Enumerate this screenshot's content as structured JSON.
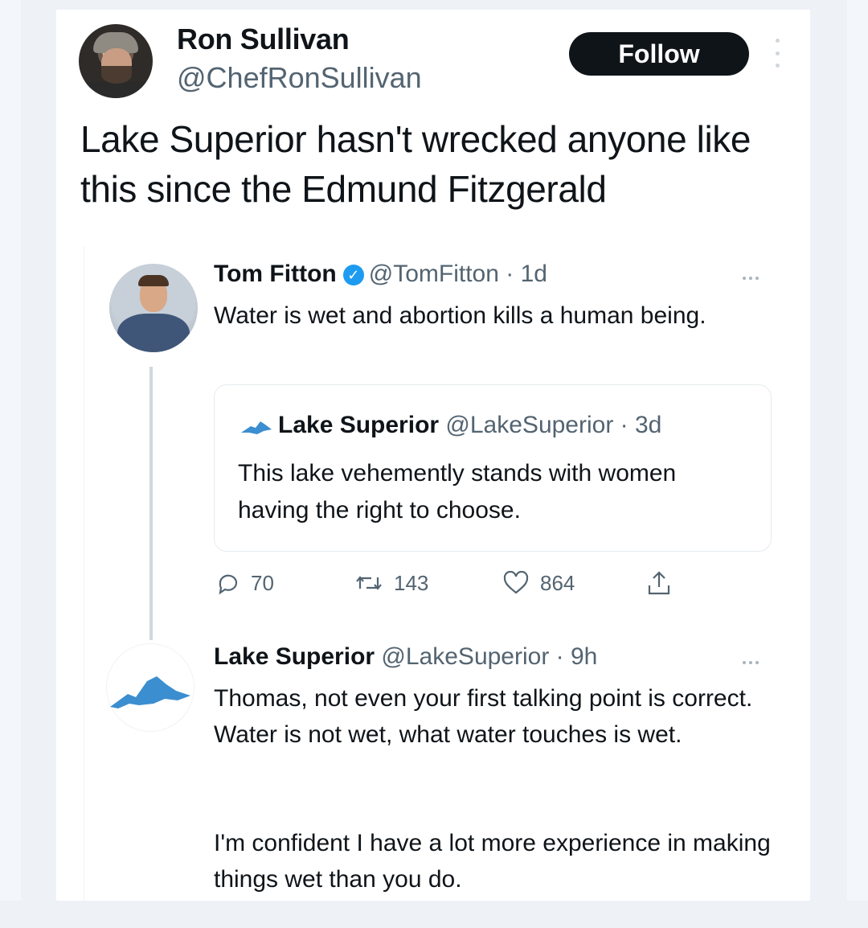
{
  "post": {
    "author_name": "Ron Sullivan",
    "author_handle": "@ChefRonSullivan",
    "follow_label": "Follow",
    "text": "Lake Superior hasn't wrecked anyone like this since the Edmund Fitzgerald"
  },
  "quoted_tweet": {
    "author_name": "Tom Fitton",
    "author_handle": "@TomFitton",
    "time": "· 1d",
    "text": "Water is wet and abortion kills a human being.",
    "embedded_quote": {
      "author_name": "Lake Superior",
      "author_handle": "@LakeSuperior",
      "time": "· 3d",
      "text": "This lake vehemently stands with women having the right to choose."
    },
    "stats": {
      "replies": "70",
      "retweets": "143",
      "likes": "864"
    }
  },
  "reply_tweet": {
    "author_name": "Lake Superior",
    "author_handle": "@LakeSuperior",
    "time": "· 9h",
    "paragraph_1": "Thomas, not even your first talking point is correct. Water is not wet, what water touches is wet.",
    "paragraph_2": "I'm confident I have a lot more experience in making things wet than you do."
  },
  "colors": {
    "text": "#0f1419",
    "secondary": "#536471",
    "verified": "#1d9bf0",
    "lake": "#3b8ed0",
    "follow_bg": "#0f1419"
  },
  "icons": [
    "more-icon",
    "verified-badge-icon",
    "lake-icon",
    "reply-icon",
    "retweet-icon",
    "like-icon",
    "share-icon"
  ]
}
